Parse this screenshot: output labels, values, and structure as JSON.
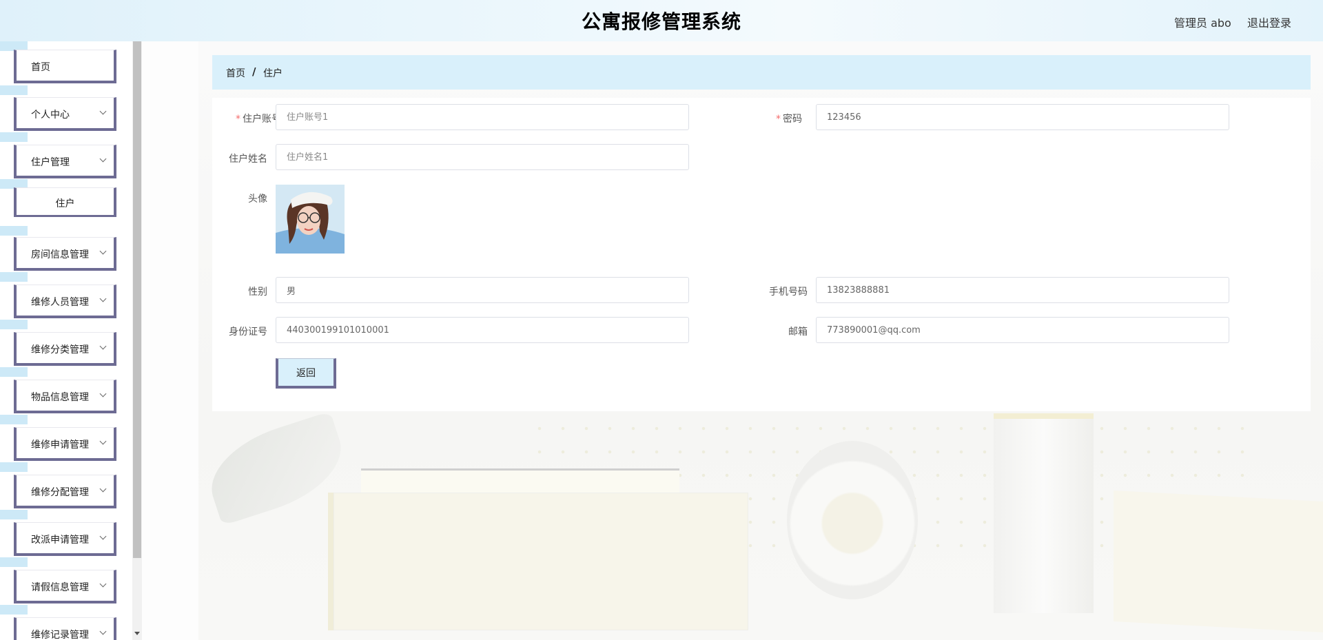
{
  "header": {
    "title": "公寓报修管理系统",
    "user": "管理员 abo",
    "logout": "退出登录"
  },
  "sidebar": {
    "items": [
      {
        "label": "首页",
        "has_submenu": false
      },
      {
        "label": "个人中心",
        "has_submenu": true
      },
      {
        "label": "住户管理",
        "has_submenu": true,
        "expanded": true
      },
      {
        "label": "住户",
        "submenu_item": true
      },
      {
        "label": "房间信息管理",
        "has_submenu": true
      },
      {
        "label": "维修人员管理",
        "has_submenu": true
      },
      {
        "label": "维修分类管理",
        "has_submenu": true
      },
      {
        "label": "物品信息管理",
        "has_submenu": true
      },
      {
        "label": "维修申请管理",
        "has_submenu": true
      },
      {
        "label": "维修分配管理",
        "has_submenu": true
      },
      {
        "label": "改派申请管理",
        "has_submenu": true
      },
      {
        "label": "请假信息管理",
        "has_submenu": true
      },
      {
        "label": "维修记录管理",
        "has_submenu": true
      }
    ]
  },
  "breadcrumb": {
    "home": "首页",
    "separator": "/",
    "current": "住户"
  },
  "form": {
    "account": {
      "label": "住户账号",
      "required": true,
      "placeholder": "住户账号1"
    },
    "password": {
      "label": "密码",
      "required": true,
      "value": "123456"
    },
    "name": {
      "label": "住户姓名",
      "placeholder": "住户姓名1"
    },
    "avatar": {
      "label": "头像"
    },
    "gender": {
      "label": "性别",
      "value": "男"
    },
    "phone": {
      "label": "手机号码",
      "value": "13823888881"
    },
    "id_card": {
      "label": "身份证号",
      "value": "440300199101010001"
    },
    "email": {
      "label": "邮箱",
      "value": "773890001@qq.com"
    },
    "required_mark": "*",
    "back_button": "返回"
  },
  "colors": {
    "accent_border": "#6d6b93",
    "breadcrumb_bg": "#d9f0fb",
    "required": "#f56c6c"
  }
}
